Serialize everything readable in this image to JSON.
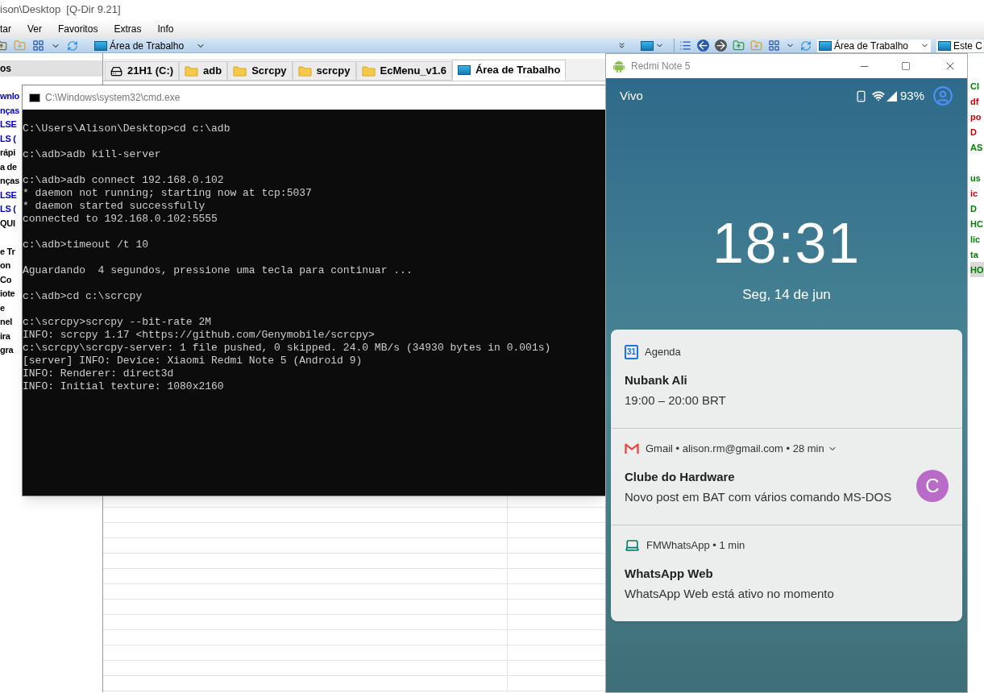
{
  "qdir": {
    "title": "ison\\Desktop  [Q-Dir 9.21]",
    "menu": [
      "tar",
      "Ver",
      "Favoritos",
      "Extras",
      "Info"
    ],
    "address_left": "Área de Trabalho",
    "address_right": "Área de Trabalho",
    "address_right_2": "Este C",
    "sidebar_header": "os",
    "sidebar_items": [
      {
        "label": "wnlo",
        "color": "#0000cc"
      },
      {
        "label": "nças",
        "color": "#0000cc"
      },
      {
        "label": "LSE",
        "color": "#0000cc"
      },
      {
        "label": "LS (",
        "color": "#0000cc"
      },
      {
        "label": "rápi",
        "color": "#000000"
      },
      {
        "label": "a de",
        "color": "#000000"
      },
      {
        "label": "nças",
        "color": "#000000"
      },
      {
        "label": "LSE",
        "color": "#0000cc"
      },
      {
        "label": "LS (",
        "color": "#0000cc"
      },
      {
        "label": "QUI",
        "color": "#000000"
      },
      {
        "label": "e Tr",
        "color": "#000000"
      },
      {
        "label": "on",
        "color": "#000000"
      },
      {
        "label": "Co",
        "color": "#000000"
      },
      {
        "label": "iote",
        "color": "#000000"
      },
      {
        "label": "e",
        "color": "#000000"
      },
      {
        "label": "nel",
        "color": "#000000"
      },
      {
        "label": "ira",
        "color": "#000000"
      },
      {
        "label": "gra",
        "color": "#000000"
      }
    ],
    "tabs": [
      {
        "label": "21H1 (C:)",
        "kind": "drive",
        "selected": false
      },
      {
        "label": "adb",
        "kind": "folder",
        "selected": false
      },
      {
        "label": "Scrcpy",
        "kind": "folder",
        "selected": false
      },
      {
        "label": "scrcpy",
        "kind": "folder",
        "selected": false
      },
      {
        "label": "EcMenu_v1.6",
        "kind": "folder",
        "selected": false
      },
      {
        "label": "Área de Trabalho",
        "kind": "desktop",
        "selected": true
      }
    ],
    "right_items": [
      {
        "label": "CI",
        "color": "#008000",
        "selected": false
      },
      {
        "label": "df",
        "color": "#cc0000",
        "selected": false
      },
      {
        "label": "po",
        "color": "#cc0000",
        "selected": false
      },
      {
        "label": "D",
        "color": "#cc0000",
        "selected": false
      },
      {
        "label": "AS",
        "color": "#008000",
        "selected": false
      },
      {
        "label": "us",
        "color": "#008000",
        "selected": false
      },
      {
        "label": "ic",
        "color": "#cc0000",
        "selected": false
      },
      {
        "label": "D",
        "color": "#008000",
        "selected": false
      },
      {
        "label": "HC",
        "color": "#008000",
        "selected": false
      },
      {
        "label": "lic",
        "color": "#008000",
        "selected": false
      },
      {
        "label": "ta",
        "color": "#008000",
        "selected": false
      },
      {
        "label": "HO",
        "color": "#008000",
        "selected": true
      }
    ]
  },
  "cmd": {
    "title": "C:\\Windows\\system32\\cmd.exe",
    "blocks": [
      [
        "C:\\Users\\Alison\\Desktop>cd c:\\adb"
      ],
      [
        "c:\\adb>adb kill-server"
      ],
      [
        "c:\\adb>adb connect 192.168.0.102",
        "* daemon not running; starting now at tcp:5037",
        "* daemon started successfully",
        "connected to 192.168.0.102:5555"
      ],
      [
        "c:\\adb>timeout /t 10"
      ],
      [
        "Aguardando  4 segundos, pressione uma tecla para continuar ..."
      ],
      [
        "c:\\adb>cd c:\\scrcpy"
      ],
      [
        "c:\\scrcpy>scrcpy --bit-rate 2M",
        "INFO: scrcpy 1.17 <https://github.com/Genymobile/scrcpy>",
        "c:\\scrcpy\\scrcpy-server: 1 file pushed, 0 skipped. 24.0 MB/s (34930 bytes in 0.001s)",
        "[server] INFO: Device: Xiaomi Redmi Note 5 (Android 9)",
        "INFO: Renderer: direct3d",
        "INFO: Initial texture: 1080x2160"
      ]
    ]
  },
  "phone": {
    "window_title": "Redmi Note 5",
    "carrier": "Vivo",
    "battery": "93%",
    "time": "18:31",
    "date": "Seg, 14 de jun",
    "notifications": [
      {
        "kind": "calendar",
        "icon_text": "31",
        "header": "Agenda",
        "expandable": false,
        "title": "Nubank Ali",
        "body": "19:00 – 20:00 BRT"
      },
      {
        "kind": "gmail",
        "header": "Gmail • alison.rm@gmail.com • 28 min",
        "expandable": true,
        "title": "Clube do Hardware",
        "body": "Novo post em BAT com vários comando MS-DOS",
        "avatar": {
          "letter": "C",
          "color": "#b86cc8"
        }
      },
      {
        "kind": "device",
        "header": "FMWhatsApp • 1 min",
        "expandable": false,
        "title": "WhatsApp Web",
        "body": "WhatsApp Web está ativo no momento"
      }
    ]
  }
}
